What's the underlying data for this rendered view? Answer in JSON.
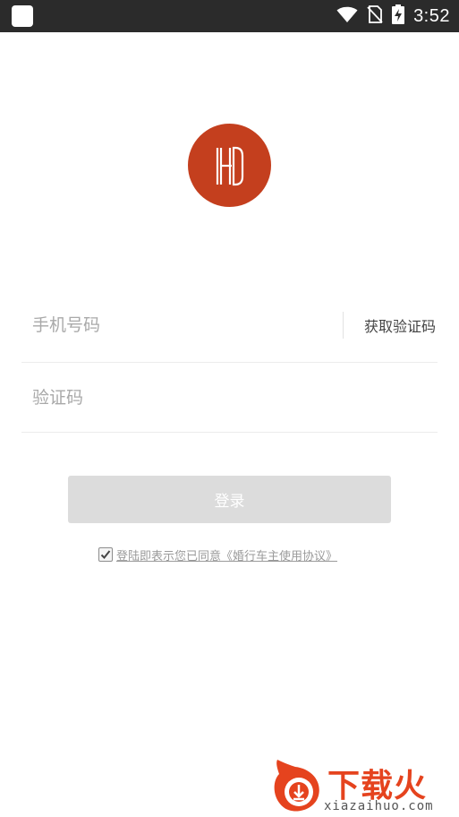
{
  "status_bar": {
    "time": "3:52",
    "icons": [
      "wifi-icon",
      "no-sim-icon",
      "battery-charging-icon"
    ]
  },
  "logo": {
    "icon": "hd-logo-icon",
    "color": "#c43f1e"
  },
  "form": {
    "phone_placeholder": "手机号码",
    "get_code_label": "获取验证码",
    "code_placeholder": "验证码"
  },
  "login_button": {
    "label": "登录"
  },
  "agreement": {
    "checked": true,
    "text": "登陆即表示您已同意《婚行车主使用协议》"
  },
  "watermark": {
    "title": "下载火",
    "url": "xiazaihuo.com",
    "color": "#e5431e"
  }
}
